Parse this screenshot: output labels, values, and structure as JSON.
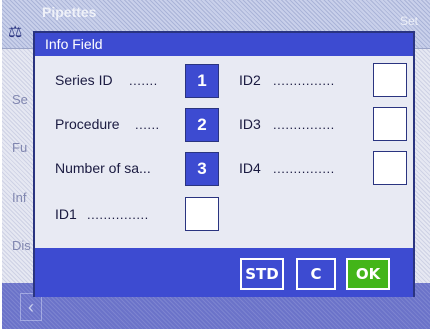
{
  "background": {
    "title": "Pipettes",
    "title_right": "Set",
    "items": [
      "Se",
      "Fu",
      "Inf",
      "Dis"
    ]
  },
  "dialog": {
    "title": "Info Field",
    "fields_left": [
      {
        "label": "Series ID",
        "dots": ".......",
        "value": "1"
      },
      {
        "label": "Procedure",
        "dots": "......",
        "value": "2"
      },
      {
        "label": "Number of sa...",
        "dots": "",
        "value": "3"
      },
      {
        "label": "ID1",
        "dots": "...............",
        "value": ""
      }
    ],
    "fields_right": [
      {
        "label": "ID2",
        "dots": "...............",
        "value": ""
      },
      {
        "label": "ID3",
        "dots": "...............",
        "value": ""
      },
      {
        "label": "ID4",
        "dots": "...............",
        "value": ""
      }
    ],
    "buttons": {
      "std": "STD",
      "c": "C",
      "ok": "OK"
    }
  },
  "colors": {
    "accent": "#3d4bd1",
    "dark": "#2a3480",
    "ok": "#43b519"
  }
}
